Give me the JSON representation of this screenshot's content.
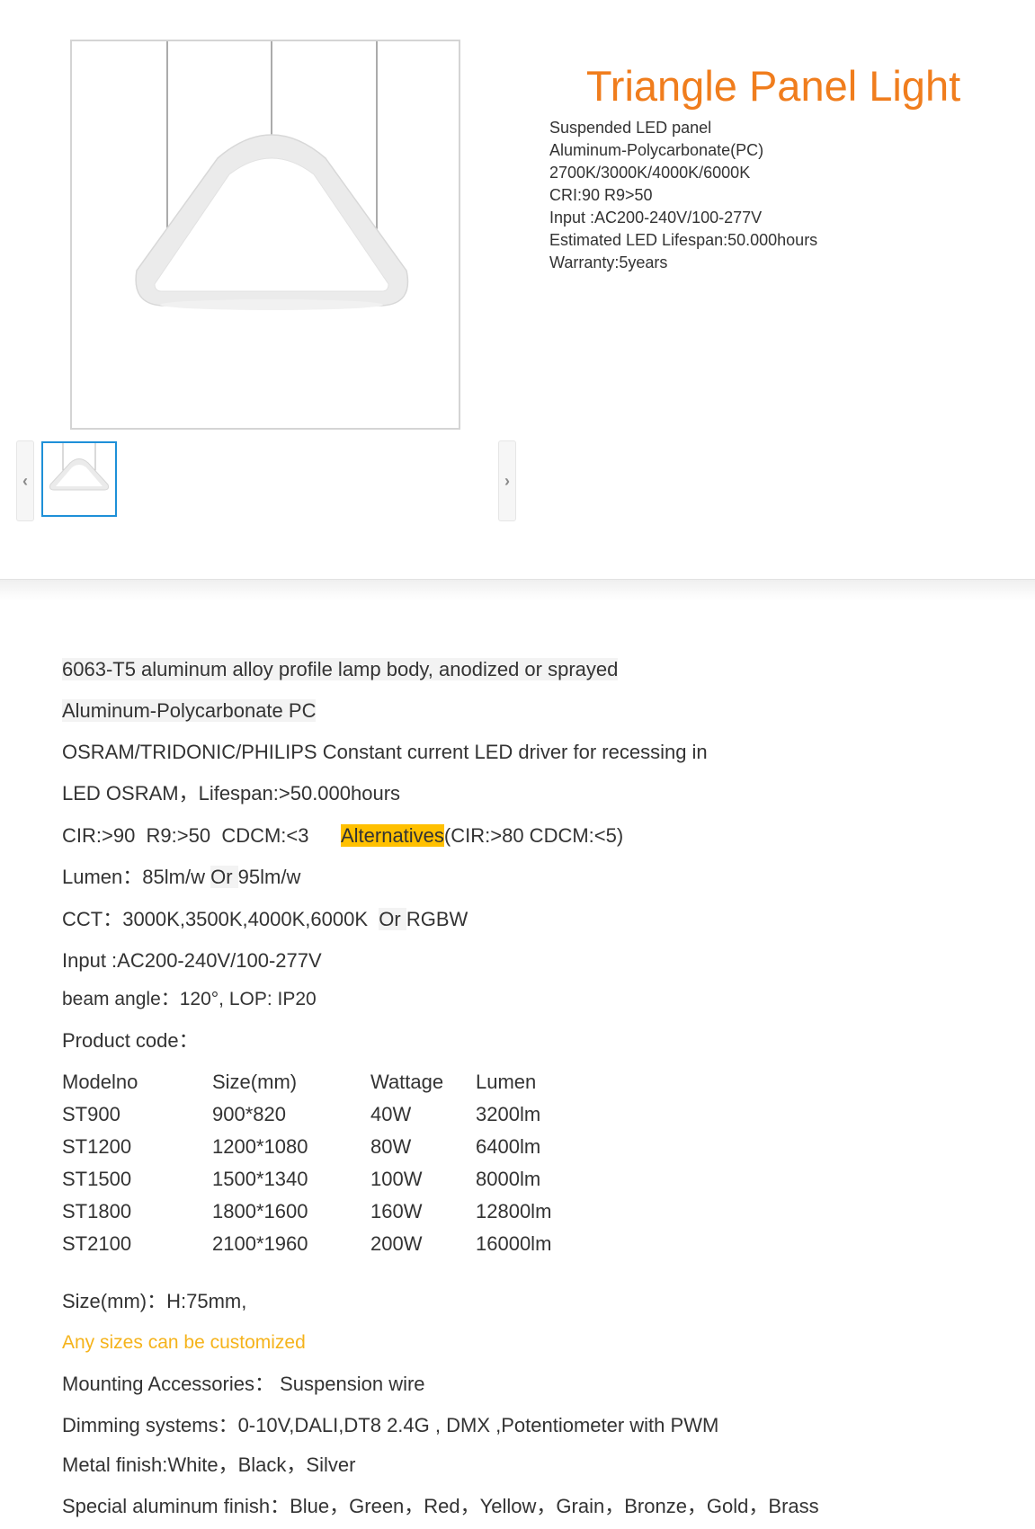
{
  "product": {
    "title": "Triangle Panel Light",
    "specs": [
      "Suspended LED panel",
      "Aluminum-Polycarbonate(PC)",
      "2700K/3000K/4000K/6000K",
      "CRI:90 R9>50",
      "Input :AC200-240V/100-277V",
      "Estimated LED Lifespan:50.000hours",
      "Warranty:5years"
    ]
  },
  "gallery": {
    "prev_icon": "‹",
    "next_icon": "›"
  },
  "detail": {
    "body": "6063-T5 aluminum alloy profile lamp body, anodized or sprayed",
    "diffuser": "Aluminum-Polycarbonate  PC ",
    "driver": "OSRAM/TRIDONIC/PHILIPS Constant current LED driver for recessing in",
    "led": "LED  OSRAM，Lifespan:>50.000hours",
    "cri_main": "CIR:>90  R9:>50  CDCM:<3      ",
    "cri_alt_label": "Alternatives",
    "cri_alt_value": "(CIR:>80   CDCM:<5)",
    "lumen_prefix": "Lumen：85lm/w ",
    "lumen_or": "Or ",
    "lumen_alt": "95lm/w",
    "cct_prefix": "CCT：3000K,3500K,4000K,6000K  ",
    "cct_or": "Or ",
    "cct_alt": "RGBW",
    "input": "Input :AC200-240V/100-277V",
    "beam": "beam angle：120°,   LOP:  IP20",
    "product_code_label": "Product code：",
    "table": {
      "headers": [
        "Modelno",
        "Size(mm)",
        "Wattage",
        "Lumen"
      ],
      "rows": [
        [
          "ST900",
          "900*820",
          "40W",
          "3200lm"
        ],
        [
          "ST1200",
          "1200*1080",
          "80W",
          "6400lm"
        ],
        [
          "ST1500",
          "1500*1340",
          "100W",
          "8000lm"
        ],
        [
          "ST1800",
          "1800*1600",
          "160W",
          "12800lm"
        ],
        [
          "ST2100",
          "2100*1960",
          "200W",
          "16000lm"
        ]
      ]
    },
    "size": "Size(mm)：H:75mm,",
    "custom": "Any sizes can be customized",
    "mounting": "Mounting Accessories： Suspension wire",
    "dimming": "Dimming systems：0-10V,DALI,DT8  2.4G , DMX ,Potentiometer  with PWM",
    "metal_finish": "Metal finish:White，Black，Silver",
    "special_finish": "Special aluminum finish：Blue，Green，Red，Yellow，Grain，Bronze，Gold，Brass"
  },
  "colors": {
    "title": "#f07d1d",
    "highlight": "#ffc000",
    "custom_text": "#f5b31b",
    "thumb_border": "#1e90d8"
  }
}
